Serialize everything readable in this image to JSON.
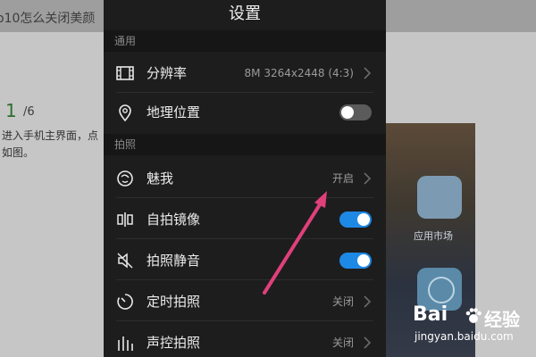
{
  "background_page": {
    "title_fragment": "o10怎么关闭美颜",
    "step_number": "1",
    "step_total": "/6",
    "body_line1": "进入手机主界面，点",
    "body_line2": "如图。",
    "app_label": "应用市场"
  },
  "settings": {
    "title": "设置",
    "sections": [
      {
        "header": "通用",
        "rows": [
          {
            "label": "分辨率",
            "value": "8M 3264x2448 (4:3)",
            "control": "chevron",
            "icon": "film-icon"
          },
          {
            "label": "地理位置",
            "control": "toggle",
            "on": false,
            "icon": "location-pin-icon"
          }
        ]
      },
      {
        "header": "拍照",
        "rows": [
          {
            "label": "魅我",
            "value": "开启",
            "control": "chevron",
            "icon": "beauty-face-icon"
          },
          {
            "label": "自拍镜像",
            "control": "toggle",
            "on": true,
            "icon": "mirror-icon"
          },
          {
            "label": "拍照静音",
            "control": "toggle",
            "on": true,
            "icon": "mute-speaker-icon"
          },
          {
            "label": "定时拍照",
            "value": "关闭",
            "control": "chevron",
            "icon": "timer-icon"
          },
          {
            "label": "声控拍照",
            "value": "关闭",
            "control": "chevron",
            "icon": "voice-control-icon"
          }
        ]
      }
    ]
  },
  "watermark": {
    "brand": "Bai",
    "brand_cn": "经验",
    "url": "jingyan.baidu.com"
  },
  "colors": {
    "panel_bg": "#1d1d1d",
    "toggle_on": "#1e88e5",
    "arrow": "#e0407a"
  }
}
